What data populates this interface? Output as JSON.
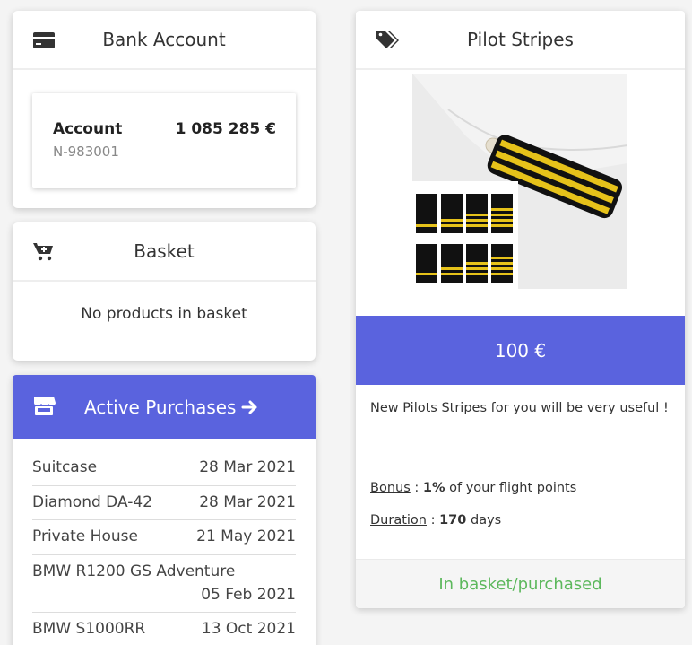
{
  "bank": {
    "title": "Bank Account",
    "icon": "credit-card-icon",
    "account_label": "Account",
    "account_number": "N-983001",
    "balance": "1 085 285 €"
  },
  "basket": {
    "title": "Basket",
    "icon": "cart-icon",
    "empty_text": "No products in basket"
  },
  "purchases": {
    "title": "Active Purchases",
    "icon": "store-icon",
    "arrow_icon": "arrow-right-icon",
    "items": [
      {
        "name": "Suitcase",
        "date": "28 Mar 2021"
      },
      {
        "name": "Diamond DA-42",
        "date": "28 Mar 2021"
      },
      {
        "name": "Private House",
        "date": "21 May 2021"
      },
      {
        "name": "BMW R1200 GS Adventure",
        "date": "05 Feb 2021"
      },
      {
        "name": "BMW S1000RR",
        "date": "13 Oct 2021"
      }
    ]
  },
  "product": {
    "title": "Pilot Stripes",
    "icon": "tags-icon",
    "price": "100 €",
    "description": "New Pilots Stripes for you will be very useful !",
    "bonus_label": "Bonus",
    "bonus_value": "1%",
    "bonus_suffix": "of your flight points",
    "duration_label": "Duration",
    "duration_value": "170",
    "duration_suffix": "days",
    "status": "In basket/purchased"
  },
  "colors": {
    "accent": "#5a63de",
    "success": "#5cb85c"
  }
}
